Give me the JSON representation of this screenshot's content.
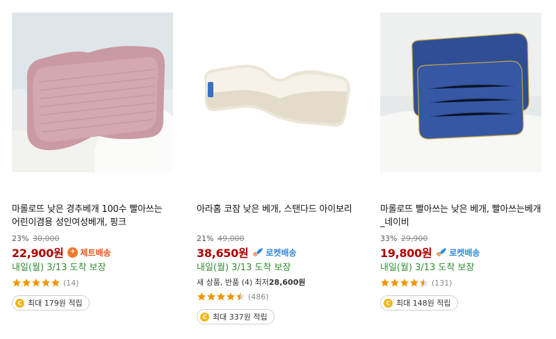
{
  "products": [
    {
      "image_desc": "pink-ribbed-pillow",
      "title": "마롤로뜨 낮은 경추베개 100수 빨아쓰는 어린이겸용 성인여성베개, 핑크",
      "discount": "23%",
      "original_price": "30,000",
      "price": "22,900원",
      "badge": "제트배송",
      "delivery": "내일(월) 3/13 도착 보장",
      "extra": "",
      "rating": 5,
      "reviews": "(14)",
      "reward": "최대 179원 적립"
    },
    {
      "image_desc": "white-contour-pillow",
      "title": "아라홈 코잠 낮은 베개, 스탠다드 아이보리",
      "discount": "21%",
      "original_price": "49,000",
      "price": "38,650원",
      "badge": "로켓배송",
      "delivery": "내일(월) 3/13 도착 보장",
      "extra_prefix": "새 상품, 반품 (4) 최저",
      "extra_price": "28,600원",
      "rating": 4.5,
      "reviews": "(486)",
      "reward": "최대 337원 적립"
    },
    {
      "image_desc": "navy-pillows",
      "title": "마롤로뜨 빨아쓰는 낮은 베개, 빨아쓰는베개_네이비",
      "discount": "33%",
      "original_price": "29,900",
      "price": "19,800원",
      "badge": "로켓배송",
      "delivery": "내일(월) 3/13 도착 보장",
      "extra": "",
      "rating": 4.5,
      "reviews": "(131)",
      "reward": "최대 148원 적립"
    }
  ],
  "colors": {
    "price": "#ae0000",
    "delivery": "#2f8a2f",
    "star": "#f29400",
    "jet": "#e8561f",
    "rocket": "#2d8ad8",
    "coin": "#f3b61c"
  },
  "icons": {
    "jet": "jet-delivery-icon",
    "rocket": "rocket-icon",
    "coin": "coin-icon",
    "star": "star-icon"
  }
}
